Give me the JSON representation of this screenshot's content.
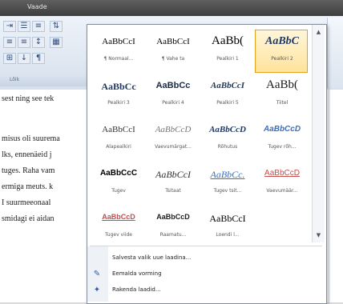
{
  "window": {
    "title": "Vaade"
  },
  "ribbon": {
    "icons": [
      "indent-icon",
      "list-icon",
      "align-icon",
      "sort-icon",
      "pilcrow-icon",
      "border-icon"
    ],
    "group_label": "Lõik"
  },
  "document": {
    "lines": [
      "sest ning see tek",
      "misus oli suurema",
      "lks, ennenäeid j",
      "tuges. Raha vam",
      "ermiga meuts. k",
      "I suurmeeonaal",
      "smidagi ei aidan"
    ]
  },
  "styles": [
    {
      "sample": "AaBbCcI",
      "name": "¶ Normaal..."
    },
    {
      "sample": "AaBbCcI",
      "name": "¶ Vahe ta"
    },
    {
      "sample": "AaBb(",
      "name": "Pealkiri 1"
    },
    {
      "sample": "AaBbC",
      "name": "Pealkiri 2",
      "selected": true
    },
    {
      "sample": "AaBbCc",
      "name": "Pealkiri 3"
    },
    {
      "sample": "AaBbCc",
      "name": "Pealkiri 4"
    },
    {
      "sample": "AaBbCcI",
      "name": "Pealkiri 5"
    },
    {
      "sample": "AaBb(",
      "name": "Tiitel"
    },
    {
      "sample": "AaBbCcI",
      "name": "Alapealkiri"
    },
    {
      "sample": "AaBbCcD",
      "name": "Vaevumärgat..."
    },
    {
      "sample": "AaBbCcD",
      "name": "Rõhutus"
    },
    {
      "sample": "AaBbCcD",
      "name": "Tugev rõh..."
    },
    {
      "sample": "AaBbCcC",
      "name": "Tugev"
    },
    {
      "sample": "AaBbCcI",
      "name": "Tsitaat"
    },
    {
      "sample": "AaBbCc.",
      "name": "Tugev tsit..."
    },
    {
      "sample": "AaBbCcD",
      "name": "Vaevumäär..."
    },
    {
      "sample": "AaBbCcD",
      "name": "Tugev viide"
    },
    {
      "sample": "AaBbCcD",
      "name": "Raamatu..."
    },
    {
      "sample": "AaBbCcI",
      "name": "Loendi l..."
    }
  ],
  "commands": [
    {
      "label": "Salvesta valik uue laadina...",
      "icon": "save-style-icon"
    },
    {
      "label": "Eemalda vorming",
      "icon": "clear-formatting-icon"
    },
    {
      "label": "Rakenda laadid...",
      "icon": "apply-styles-icon"
    }
  ],
  "colors": {
    "selected_border": "#e3a21a",
    "selected_fill": "#ffe39c",
    "heading_blue": "#1f3864",
    "accent_red": "#c0504d"
  }
}
